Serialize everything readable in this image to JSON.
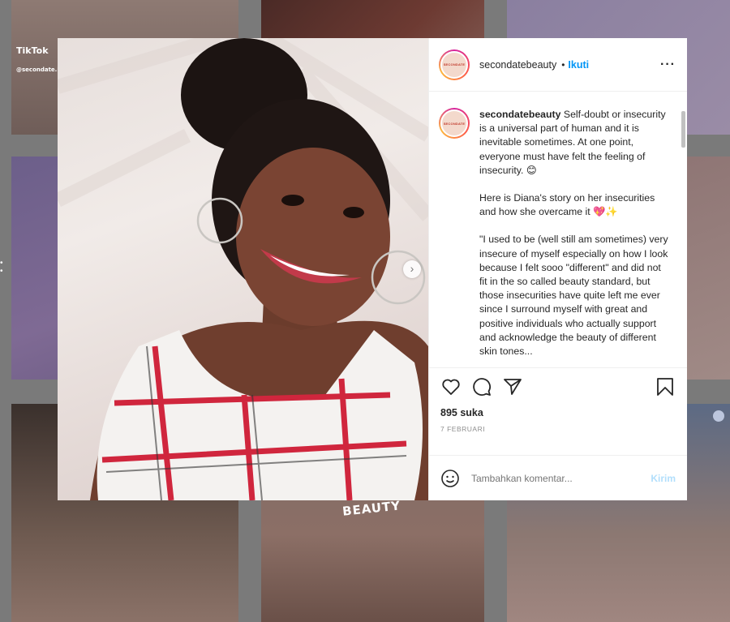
{
  "background": {
    "tiktok_label": "TikTok",
    "tiktok_handle": "@secondate.beauty",
    "product_word": "BEAUTY"
  },
  "post": {
    "username": "secondatebeauty",
    "avatar_text": "SECONDATE",
    "follow_label": "Ikuti",
    "separator": "•",
    "more_icon": "more-horizontal-icon",
    "caption": {
      "username": "secondatebeauty",
      "paragraph1": "Self-doubt or insecurity is a universal part of human and it is inevitable sometimes. At one point, everyone must have felt the feeling of insecurity. 😊",
      "paragraph2": "Here is Diana's story on her insecurities and how she overcame it 💖✨",
      "paragraph3": "\"I used to be (well still am sometimes) very insecure of myself especially on how I look because I felt sooo \"different\" and did not fit in the so called beauty standard, but those insecurities have quite left me ever since I surround myself with great and positive individuals who actually support and acknowledge the beauty of different skin tones..."
    },
    "likes": "895 suka",
    "date": "7 FEBRUARI",
    "comment_placeholder": "Tambahkan komentar...",
    "send_label": "Kirim"
  },
  "icons": {
    "like": "heart-icon",
    "comment": "comment-icon",
    "share": "send-icon",
    "save": "bookmark-icon",
    "emoji": "smile-icon",
    "next": "chevron-right-icon"
  },
  "colors": {
    "link": "#0095f6",
    "send_disabled": "#b2dffc",
    "text": "#262626",
    "muted": "#8e8e8e"
  }
}
